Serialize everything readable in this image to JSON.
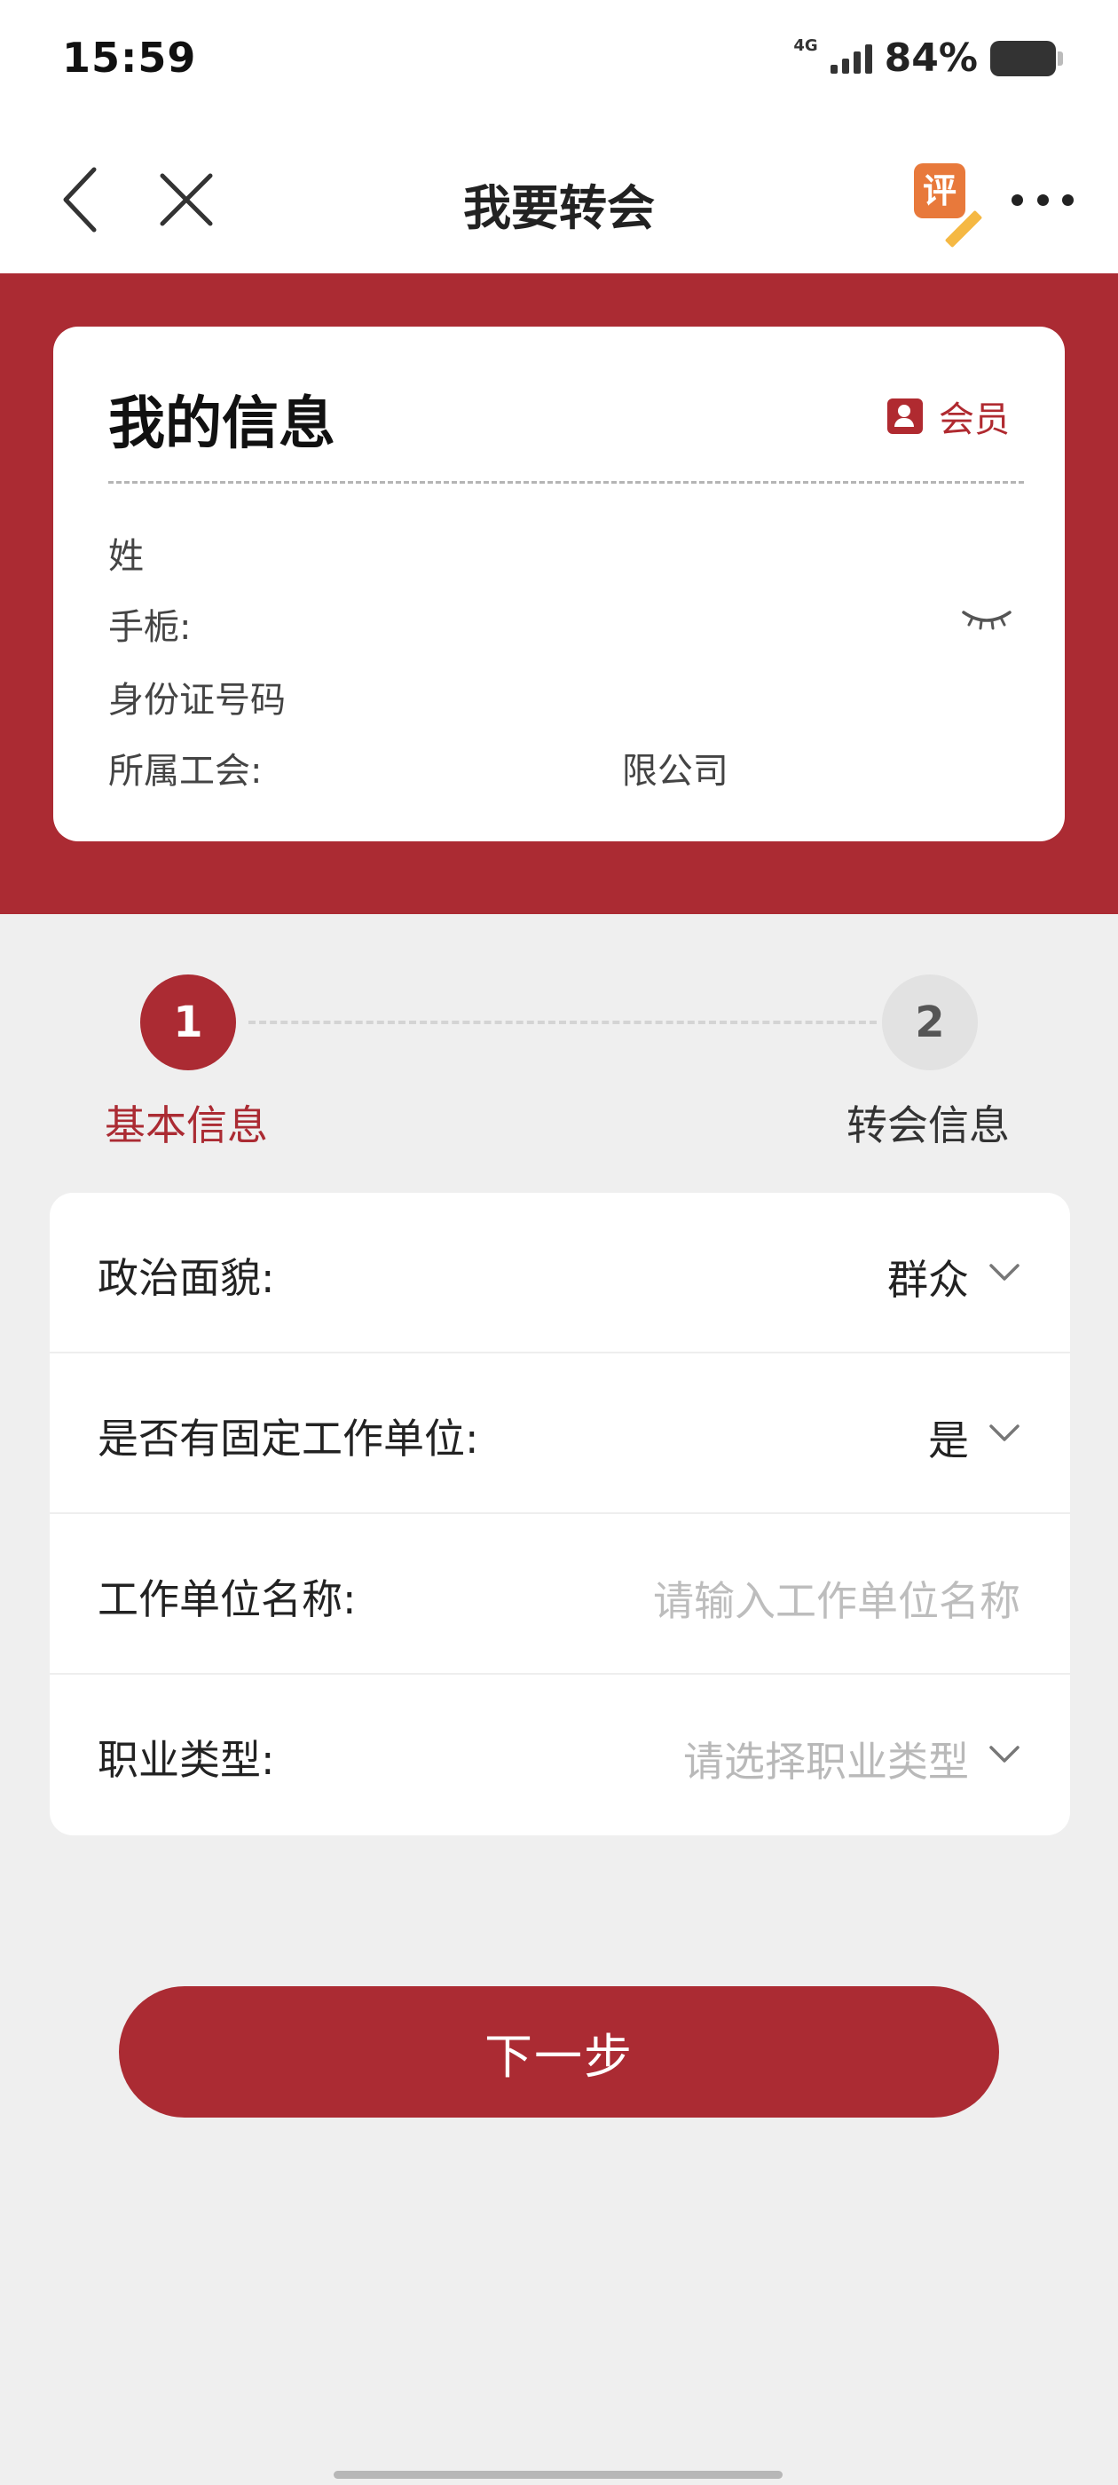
{
  "status_bar": {
    "time": "15:59",
    "network": "4G",
    "battery": "84%"
  },
  "nav": {
    "title": "我要转会",
    "rate_icon_text": "评"
  },
  "info_card": {
    "title": "我的信息",
    "badge": "会员",
    "name_label": "姓",
    "phone_label": "手栀:",
    "id_label": "身份证号码",
    "union_label": "所属工会:",
    "union_value": "限公司"
  },
  "steps": [
    {
      "number": "1",
      "label": "基本信息",
      "active": true
    },
    {
      "number": "2",
      "label": "转会信息",
      "active": false
    }
  ],
  "form": {
    "political_label": "政治面貌:",
    "political_value": "群众",
    "fixed_unit_label": "是否有固定工作单位:",
    "fixed_unit_value": "是",
    "unit_name_label": "工作单位名称:",
    "unit_name_placeholder": "请输入工作单位名称",
    "job_type_label": "职业类型:",
    "job_type_placeholder": "请选择职业类型"
  },
  "next_button": "下一步",
  "colors": {
    "brand_red": "#ab2b33",
    "page_bg": "#efefef"
  }
}
